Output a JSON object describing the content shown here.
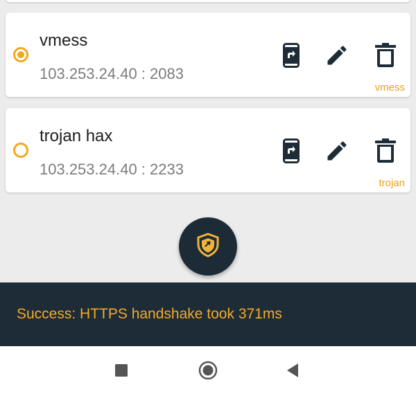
{
  "servers": [
    {
      "name": "vmess",
      "address": "103.253.24.40 : 2083",
      "type": "vmess",
      "selected": true
    },
    {
      "name": "trojan hax",
      "address": "103.253.24.40 : 2233",
      "type": "trojan",
      "selected": false
    }
  ],
  "icons": {
    "share": "share-to-phone-icon",
    "edit": "pencil-icon",
    "delete": "trash-icon",
    "fab": "shield-icon",
    "nav_recents": "square-icon",
    "nav_home": "circle-icon",
    "nav_back": "triangle-back-icon"
  },
  "snackbar": {
    "message": "Success: HTTPS handshake took 371ms"
  },
  "colors": {
    "accent": "#f0a81e",
    "dark": "#1e2c37",
    "background": "#ececec"
  }
}
